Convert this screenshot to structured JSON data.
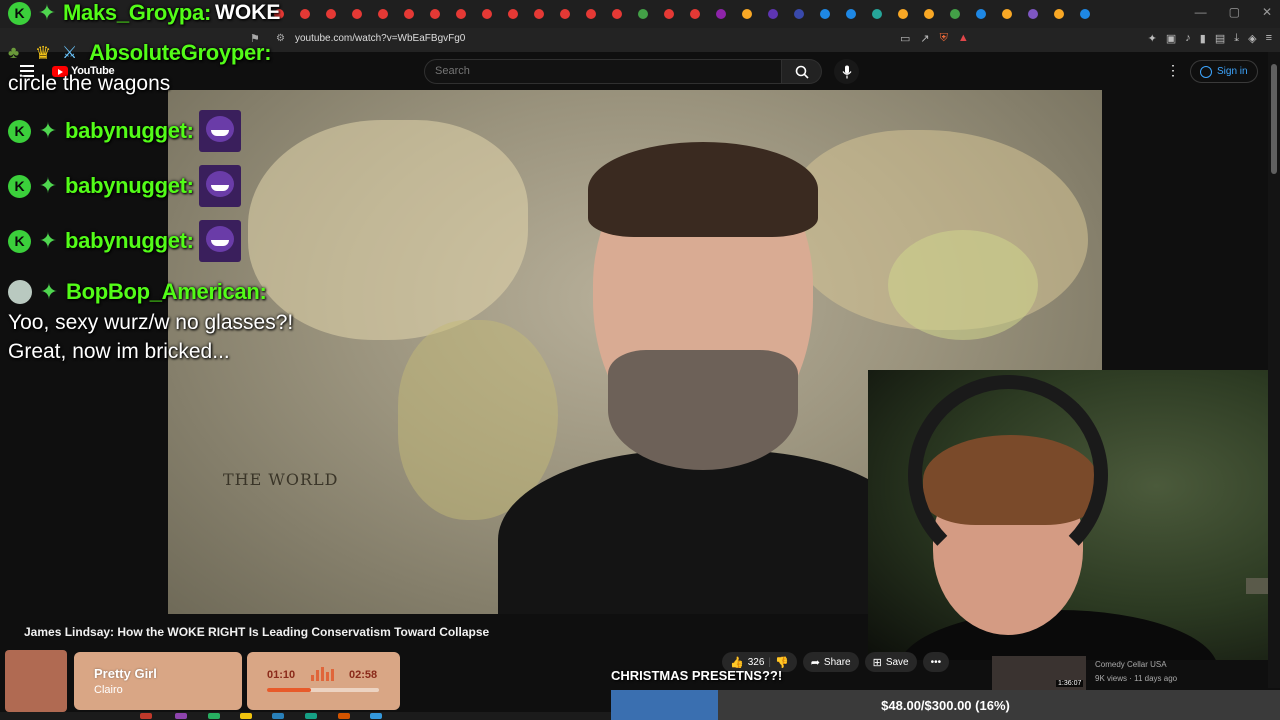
{
  "browser": {
    "url": "youtube.com/watch?v=WbEaFBgvFg0",
    "tab_colors": [
      "#e53935",
      "#e53935",
      "#e53935",
      "#e53935",
      "#e53935",
      "#e53935",
      "#e53935",
      "#e53935",
      "#e53935",
      "#e53935",
      "#e53935",
      "#e53935",
      "#e53935",
      "#e53935",
      "#43a047",
      "#e53935",
      "#e53935",
      "#8e24aa",
      "#f9a825",
      "#5e35b1",
      "#3949ab",
      "#1e88e5",
      "#1e88e5",
      "#26a69a",
      "#f9a825",
      "#f9a825",
      "#43a047",
      "#1e88e5",
      "#f9a825",
      "#7e57c2",
      "#f9a825",
      "#1e88e5"
    ]
  },
  "youtube": {
    "logo_text": "YouTube",
    "search_placeholder": "Search",
    "sign_in_label": "Sign in",
    "more_label": "⋮"
  },
  "chat": {
    "top": {
      "username": "Maks_Groypa:",
      "message": "WOKE"
    },
    "lines": [
      {
        "username": "AbsoluteGroyper:",
        "message": "circle the wagons"
      },
      {
        "username": "babynugget:"
      },
      {
        "username": "babynugget:"
      },
      {
        "username": "babynugget:"
      },
      {
        "username": "BopBop_American:",
        "message_line1": "Yoo, sexy wurz/w no glasses?!",
        "message_line2": "Great, now im bricked..."
      }
    ],
    "badge_k": "K"
  },
  "video": {
    "map_title": "THE WORLD",
    "title": "James Lindsay: How the WOKE RIGHT Is Leading Conservatism Toward Collapse",
    "likes": "326",
    "share_label": "Share",
    "save_label": "Save",
    "more_label": "•••"
  },
  "recommendation": {
    "channel": "Comedy Cellar USA",
    "meta": "9K views · 11 days ago",
    "duration": "1:36:07"
  },
  "music": {
    "song": "Pretty Girl",
    "artist": "Clairo",
    "elapsed": "01:10",
    "total": "02:58",
    "progress": 0.39
  },
  "donation": {
    "label": "CHRISTMAS PRESETNS??!",
    "goal_text": "$48.00/$300.00 (16%)",
    "progress": 0.16
  },
  "colors": {
    "chat_username": "#53fc18",
    "goal_fill": "#3a6fb0",
    "yt_red": "#ff0000",
    "signin_blue": "#3ea6ff"
  },
  "icons": [
    "search-icon",
    "mic-icon",
    "menu-icon",
    "like-icon",
    "dislike-icon",
    "share-icon",
    "save-icon",
    "person-icon",
    "bookmark-icon",
    "tune-icon"
  ]
}
